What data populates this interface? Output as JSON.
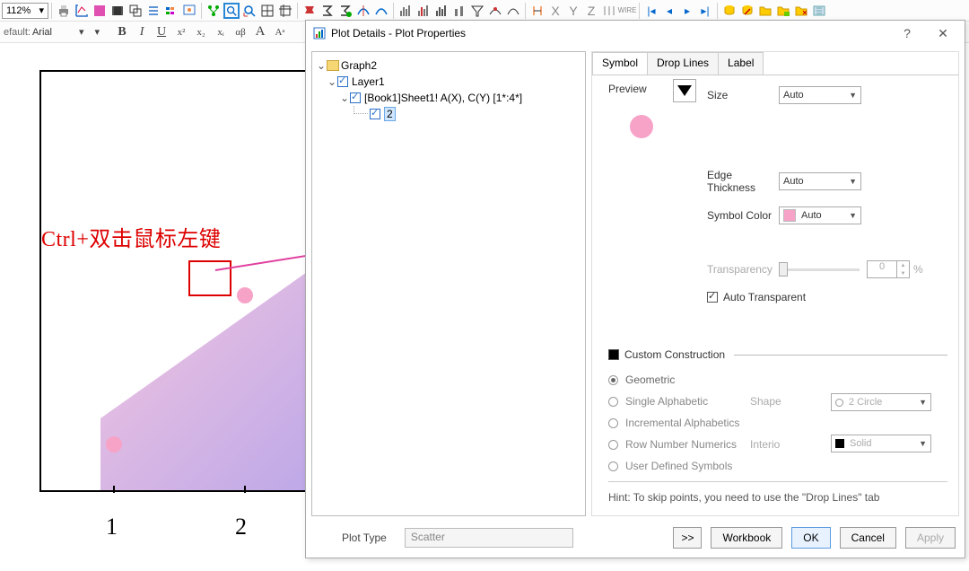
{
  "toolbar": {
    "zoom": "112%"
  },
  "format": {
    "font_prefix": "efault:",
    "font": "Arial",
    "bold": "B",
    "italic": "I",
    "underline": "U",
    "x2": "x²",
    "x_2": "x₂",
    "xi": "xᵢ",
    "ab": "αβ",
    "aa": "A",
    "super": "Aᵃ"
  },
  "plot": {
    "annotation": "Ctrl+双击鼠标左键",
    "tick1": "1",
    "tick2": "2"
  },
  "dialog": {
    "title": "Plot Details - Plot Properties",
    "tree": {
      "root": "Graph2",
      "layer": "Layer1",
      "series": "[Book1]Sheet1! A(X), C(Y) [1*:4*]",
      "subplot": "2"
    },
    "tabs": {
      "symbol": "Symbol",
      "drop": "Drop Lines",
      "label": "Label"
    },
    "symbol": {
      "preview": "Preview",
      "size": "Size",
      "size_val": "Auto",
      "edge": "Edge Thickness",
      "edge_val": "Auto",
      "color": "Symbol Color",
      "color_val": "Auto",
      "transp": "Transparency",
      "transp_val": "0",
      "pct": "%",
      "auto_trans": "Auto Transparent",
      "cc": "Custom Construction",
      "geo": "Geometric",
      "sa": "Single Alphabetic",
      "ia": "Incremental Alphabetics",
      "rn": "Row Number Numerics",
      "ud": "User Defined Symbols",
      "shape": "Shape",
      "shape_val": "2 Circle",
      "interior": "Interio",
      "interior_val": "Solid",
      "hint": "Hint: To skip points, you need to use the \"Drop Lines\" tab"
    },
    "bottom": {
      "plottype": "Plot Type",
      "plottype_val": "Scatter",
      "expand": ">>",
      "wb": "Workbook",
      "ok": "OK",
      "cancel": "Cancel",
      "apply": "Apply"
    }
  }
}
